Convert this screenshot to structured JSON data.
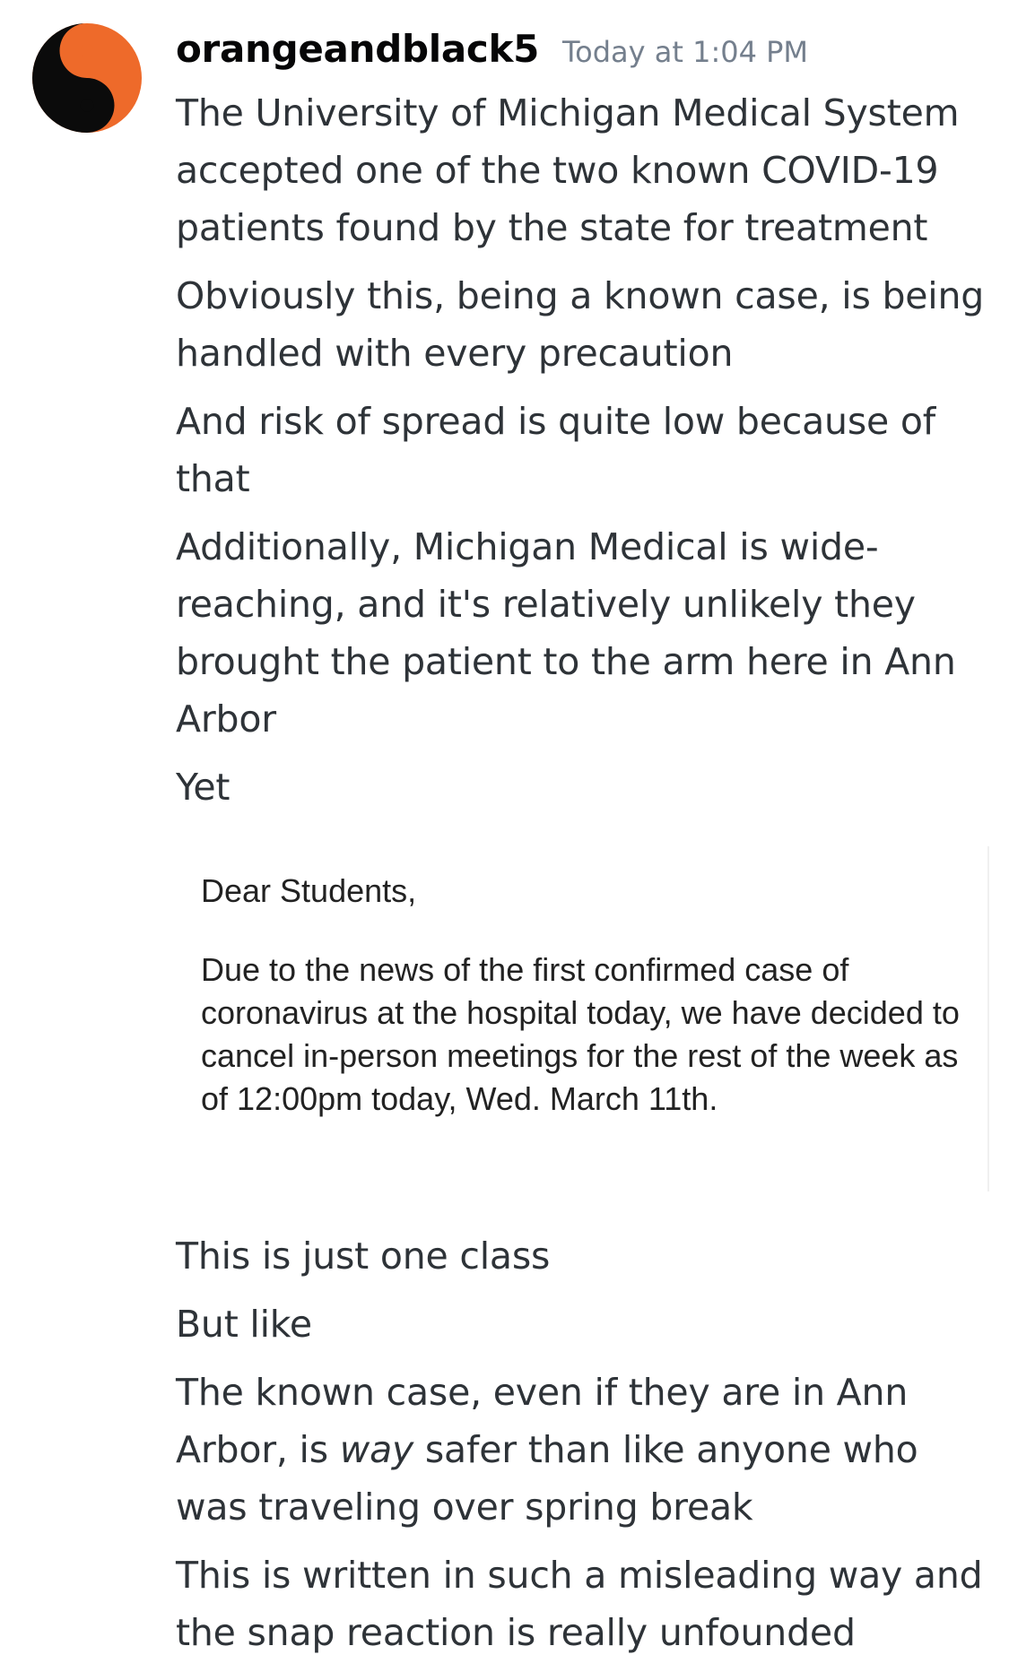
{
  "message": {
    "username": "orangeandblack5",
    "timestamp": "Today at 1:04 PM",
    "avatar": {
      "icon": "yin-yang-icon",
      "colors": {
        "dark": "#0b0b0b",
        "light": "#ee6a2a"
      }
    },
    "lines_before_image": [
      "The University of Michigan Medical System accepted one of the two known COVID-19 patients found by the state for treatment",
      "Obviously this, being a known case, is being handled with every precaution",
      "And risk of spread is quite low because of that",
      "Additionally, Michigan Medical is wide-reaching, and it's relatively unlikely they brought the patient to the arm here in Ann Arbor",
      "Yet"
    ],
    "image_attachment": {
      "greeting": "Dear Students,",
      "body": "Due to the news of the first confirmed case of coronavirus at the hospital today, we have decided to cancel in-person meetings for the rest of the week as of 12:00pm today, Wed. March 11th."
    },
    "lines_after_image": [
      "This is just one class",
      "But like"
    ],
    "italic_line": {
      "before": "The known case, even if they are in Ann Arbor, is ",
      "emphasis": "way",
      "after": " safer than like anyone who was traveling over spring break"
    },
    "final_line": "This is written in such a misleading way and the snap reaction is really unfounded"
  }
}
